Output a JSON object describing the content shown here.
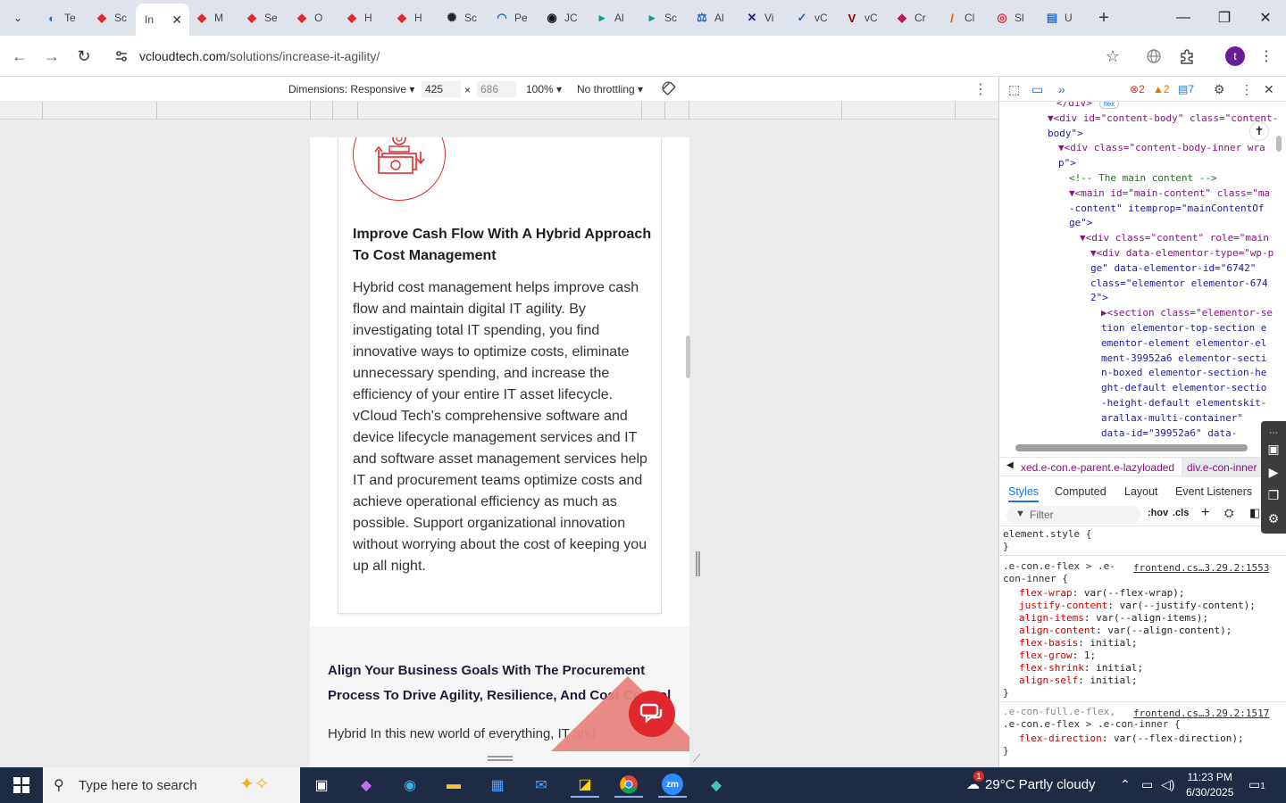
{
  "browser": {
    "tabs": [
      {
        "label": "Te",
        "color": "#1a73e8",
        "glyph": "◐"
      },
      {
        "label": "Sc",
        "color": "#e0282e",
        "glyph": "◆"
      },
      {
        "label": "In",
        "color": "#ffffff",
        "glyph": "",
        "active": true
      },
      {
        "label": "M",
        "color": "#e0282e",
        "glyph": "◆"
      },
      {
        "label": "Se",
        "color": "#e0282e",
        "glyph": "◆"
      },
      {
        "label": "O",
        "color": "#e0282e",
        "glyph": "◆"
      },
      {
        "label": "H",
        "color": "#e0282e",
        "glyph": "◆"
      },
      {
        "label": "H",
        "color": "#e0282e",
        "glyph": "◆"
      },
      {
        "label": "Sc",
        "color": "#222222",
        "glyph": "✺"
      },
      {
        "label": "Pe",
        "color": "#1565c0",
        "glyph": "◠"
      },
      {
        "label": "JC",
        "color": "#111111",
        "glyph": "◉"
      },
      {
        "label": "Al",
        "color": "#0f9d8a",
        "glyph": "▸"
      },
      {
        "label": "Sc",
        "color": "#0f9d8a",
        "glyph": "▸"
      },
      {
        "label": "Al",
        "color": "#1565c0",
        "glyph": "⚖"
      },
      {
        "label": "Vi",
        "color": "#1a237e",
        "glyph": "✕"
      },
      {
        "label": "vC",
        "color": "#1565c0",
        "glyph": "✓"
      },
      {
        "label": "vC",
        "color": "#8b0000",
        "glyph": "V"
      },
      {
        "label": "Cr",
        "color": "#c2185b",
        "glyph": "◆"
      },
      {
        "label": "Cl",
        "color": "#e65100",
        "glyph": "/"
      },
      {
        "label": "Sl",
        "color": "#e0282e",
        "glyph": "◎"
      },
      {
        "label": "U",
        "color": "#1a73e8",
        "glyph": "▤"
      }
    ],
    "new_tab": "+",
    "win_min": "—",
    "win_max": "❐",
    "win_close": "✕",
    "tab_search": "⌄",
    "url_host": "vcloudtech.com",
    "url_path": "/solutions/increase-it-agility/",
    "nav_back": "←",
    "nav_forward": "→",
    "nav_reload": "↻",
    "profile_initial": "t"
  },
  "device_toolbar": {
    "dimensions_label": "Dimensions: Responsive",
    "width": "425",
    "height": "686",
    "zoom": "100%",
    "throttling": "No throttling"
  },
  "page": {
    "card_title": "Improve Cash Flow With A Hybrid Approach To Cost Management",
    "card_body": "Hybrid cost management helps improve cash flow and maintain digital IT agility. By investigating total IT spending, you find innovative ways to optimize costs, eliminate unnecessary spending, and increase the efficiency of your entire IT asset lifecycle. vCloud Tech's comprehensive software and device lifecycle management services and IT and software asset management services help IT and procurement teams optimize costs and achieve operational efficiency as much as possible. Support organizational innovation without worrying about the cost of keeping you up all night.",
    "section_title": "Align Your Business Goals With The Procurement Process To Drive Agility, Resilience, And Cost Control",
    "section_text": "Hybrid In this new world of everything, IT and",
    "accent_color": "#e0282e"
  },
  "devtools": {
    "errors": "2",
    "warnings": "2",
    "messages": "7",
    "dom": [
      {
        "indent": 0,
        "html": "</div>",
        "badge": "flex"
      },
      {
        "indent": 1,
        "text": "▼<div id=\"content-body\" class=\"content-"
      },
      {
        "indent": 1,
        "text": "body\">"
      },
      {
        "indent": 2,
        "text": "▼<div class=\"content-body-inner wra"
      },
      {
        "indent": 2,
        "text": "p\">"
      },
      {
        "indent": 3,
        "text": "<!-- The main content -->"
      },
      {
        "indent": 3,
        "text": "▼<main id=\"main-content\" class=\"ma"
      },
      {
        "indent": 3,
        "text": "-content\" itemprop=\"mainContentOf"
      },
      {
        "indent": 3,
        "text": "ge\">"
      },
      {
        "indent": 4,
        "text": "▼<div class=\"content\" role=\"main"
      },
      {
        "indent": 5,
        "text": "▼<div data-elementor-type=\"wp-p"
      },
      {
        "indent": 5,
        "text": "ge\" data-elementor-id=\"6742\""
      },
      {
        "indent": 5,
        "text": "class=\"elementor elementor-674"
      },
      {
        "indent": 5,
        "text": "2\">"
      },
      {
        "indent": 6,
        "text": "▶<section class=\"elementor-se"
      },
      {
        "indent": 6,
        "text": "tion elementor-top-section e"
      },
      {
        "indent": 6,
        "text": "ementor-element elementor-el"
      },
      {
        "indent": 6,
        "text": "ment-39952a6 elementor-secti"
      },
      {
        "indent": 6,
        "text": "n-boxed elementor-section-he"
      },
      {
        "indent": 6,
        "text": "ght-default elementor-sectio"
      },
      {
        "indent": 6,
        "text": "-height-default elementskit-"
      },
      {
        "indent": 6,
        "text": "arallax-multi-container\""
      },
      {
        "indent": 6,
        "text": "data-id=\"39952a6\" data-"
      }
    ],
    "flex_badge": "flex",
    "crumb_1": "xed.e-con.e-parent.e-lazyloaded",
    "crumb_2": "div.e-con-inner",
    "subtabs": [
      "Styles",
      "Computed",
      "Layout",
      "Event Listeners"
    ],
    "filter_placeholder": "Filter",
    "hov": ":hov",
    "cls": ".cls",
    "element_style": "element.style {",
    "close_brace": "}",
    "rule1_selector_a": ".e-con.e-flex > .e-",
    "rule1_selector_b": "con-inner {",
    "rule1_source": "frontend.cs…3.29.2:1553",
    "rule1_props": [
      {
        "name": "flex-wrap",
        "value": "var(--flex-wrap);"
      },
      {
        "name": "justify-content",
        "value": "var(--justify-content);"
      },
      {
        "name": "align-items",
        "value": "var(--align-items);"
      },
      {
        "name": "align-content",
        "value": "var(--align-content);"
      },
      {
        "name": "flex-basis",
        "value": "initial;"
      },
      {
        "name": "flex-grow",
        "value": "1;"
      },
      {
        "name": "flex-shrink",
        "value": "initial;"
      },
      {
        "name": "align-self",
        "value": "initial;"
      }
    ],
    "rule2_selector_a": ".e-con-full.e-flex,",
    "rule2_selector_b": ".e-con.e-flex > .e-con-inner {",
    "rule2_source": "frontend.cs…3.29.2:1517",
    "rule2_prop_name": "flex-direction",
    "rule2_prop_value": "var(--flex-direction);"
  },
  "taskbar": {
    "search_placeholder": "Type here to search",
    "weather": "29°C  Partly cloudy",
    "time": "11:23 PM",
    "date": "6/30/2025",
    "notification_count": "1"
  }
}
